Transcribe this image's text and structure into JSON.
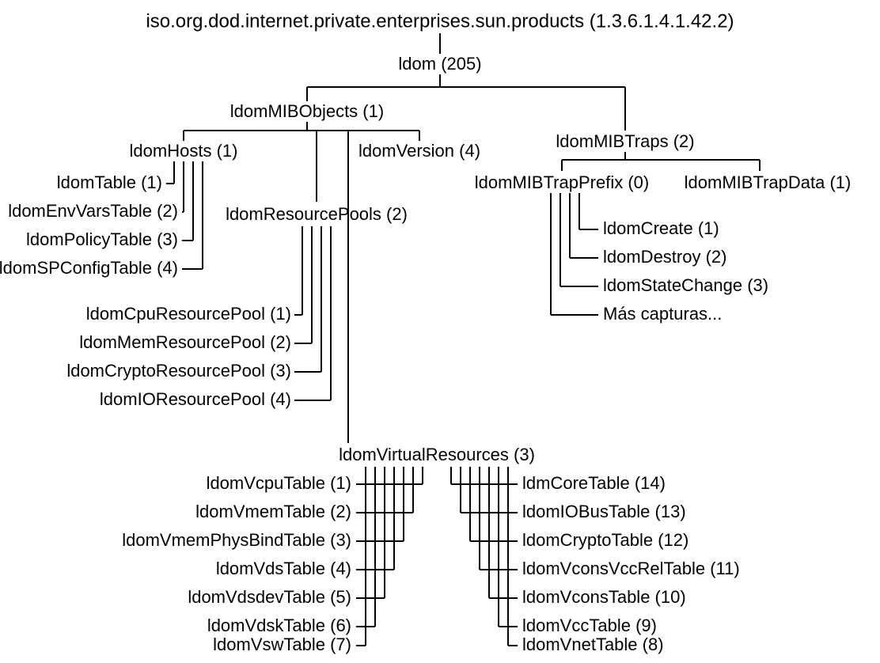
{
  "root": "iso.org.dod.internet.private.enterprises.sun.products (1.3.6.1.4.1.42.2)",
  "ldom": "ldom (205)",
  "ldomMIBObjects": "ldomMIBObjects (1)",
  "ldomMIBTraps": "ldomMIBTraps (2)",
  "ldomHosts": "ldomHosts (1)",
  "ldomVersion": "ldomVersion (4)",
  "ldomResourcePools": "ldomResourcePools (2)",
  "ldomVirtualResources": "ldomVirtualResources (3)",
  "ldomTable": "ldomTable (1)",
  "ldomEnvVarsTable": "ldomEnvVarsTable (2)",
  "ldomPolicyTable": "ldomPolicyTable (3)",
  "ldomSPConfigTable": "ldomSPConfigTable (4)",
  "ldomCpuResourcePool": "ldomCpuResourcePool (1)",
  "ldomMemResourcePool": "ldomMemResourcePool (2)",
  "ldomCryptoResourcePool": "ldomCryptoResourcePool (3)",
  "ldomIOResourcePool": "ldomIOResourcePool (4)",
  "ldomMIBTrapPrefix": "ldomMIBTrapPrefix (0)",
  "ldomMIBTrapData": "ldomMIBTrapData (1)",
  "ldomCreate": "ldomCreate (1)",
  "ldomDestroy": "ldomDestroy (2)",
  "ldomStateChange": "ldomStateChange (3)",
  "moreTraps": "Más capturas...",
  "vr": {
    "l1": "ldomVcpuTable (1)",
    "l2": "ldomVmemTable (2)",
    "l3": "ldomVmemPhysBindTable (3)",
    "l4": "ldomVdsTable (4)",
    "l5": "ldomVdsdevTable (5)",
    "l6": "ldomVdskTable (6)",
    "l7": "ldomVswTable (7)",
    "r8": "ldomVnetTable (8)",
    "r9": "ldomVccTable (9)",
    "r10": "ldomVconsTable (10)",
    "r11": "ldomVconsVccRelTable (11)",
    "r12": "ldomCryptoTable (12)",
    "r13": "ldomIOBusTable (13)",
    "r14": "ldmCoreTable (14)"
  }
}
